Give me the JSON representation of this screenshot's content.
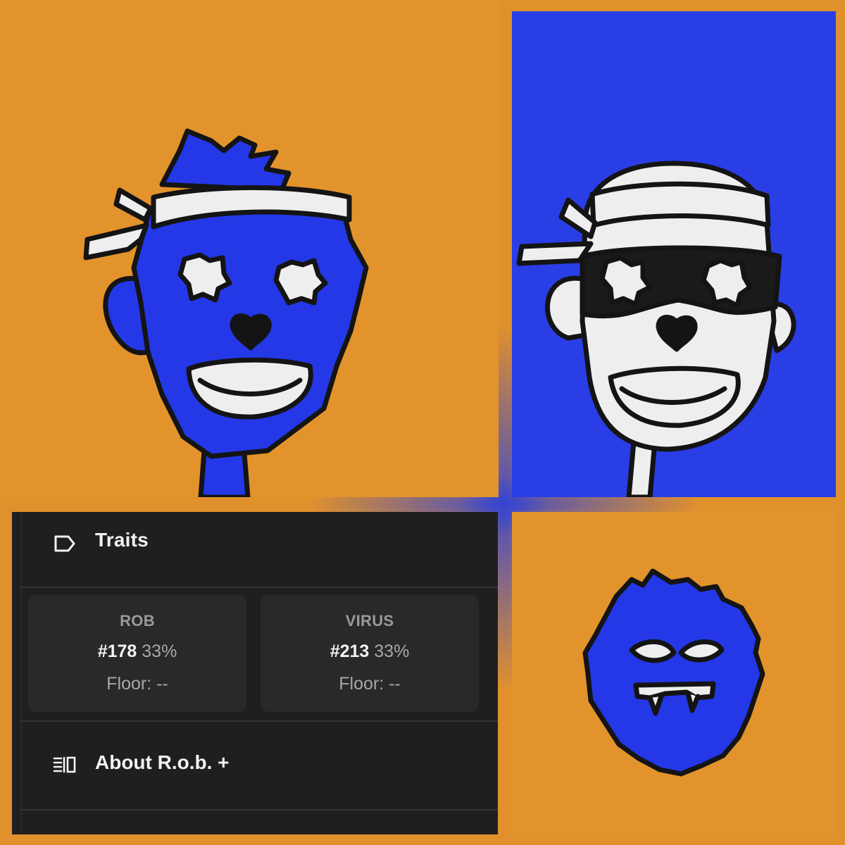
{
  "panel": {
    "section_title": "Traits",
    "traits": [
      {
        "type": "ROB",
        "value": "#178",
        "percent": "33%",
        "floor": "Floor: --"
      },
      {
        "type": "VIRUS",
        "value": "#213",
        "percent": "33%",
        "floor": "Floor: --"
      }
    ],
    "about_label": "About R.o.b. +"
  },
  "colors": {
    "orange_bg": "#e3932c",
    "blue_bg": "#2a3ee6",
    "fur_blue": "#2438e8",
    "dark_panel": "#1f1f1f",
    "card": "#292929"
  },
  "icons": [
    "tag-icon",
    "list-details-icon"
  ]
}
